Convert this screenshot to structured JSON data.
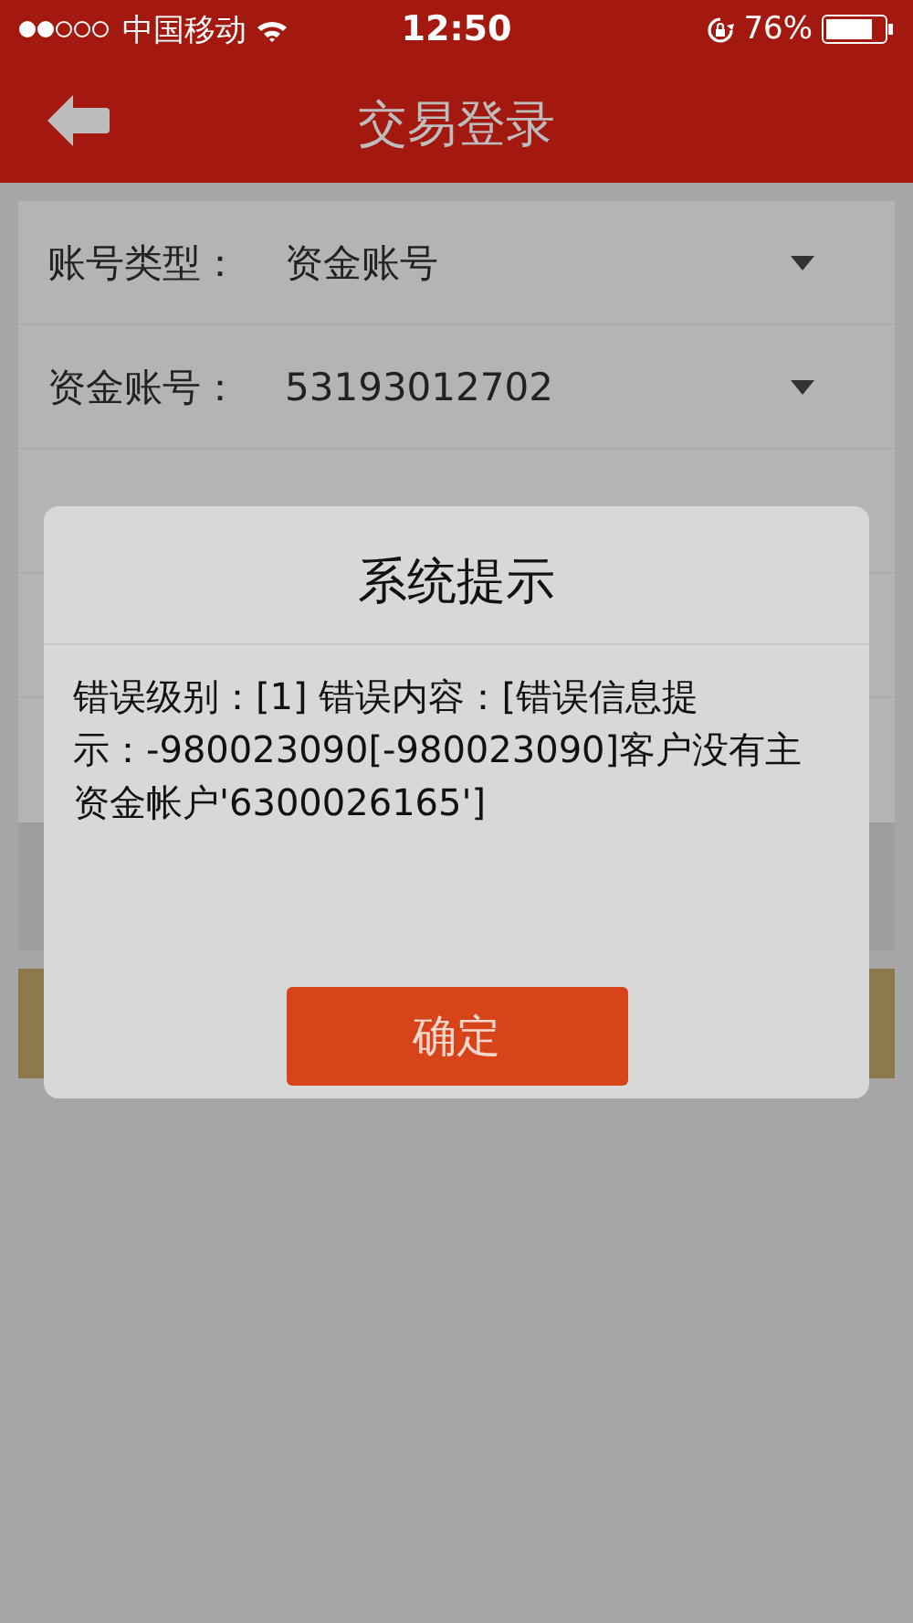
{
  "status_bar": {
    "carrier": "中国移动",
    "time": "12:50",
    "battery": "76%"
  },
  "nav": {
    "title": "交易登录"
  },
  "form": {
    "rows": [
      {
        "kind": "select",
        "label": "账号类型：",
        "value": "资金账号"
      },
      {
        "kind": "select",
        "label": "资金账号：",
        "value": "53193012702"
      }
    ]
  },
  "dialog": {
    "title": "系统提示",
    "message": "错误级别：[1] 错误内容：[错误信息提示：-980023090[-980023090]客户没有主资金帐户'6300026165']",
    "button": "确定"
  }
}
